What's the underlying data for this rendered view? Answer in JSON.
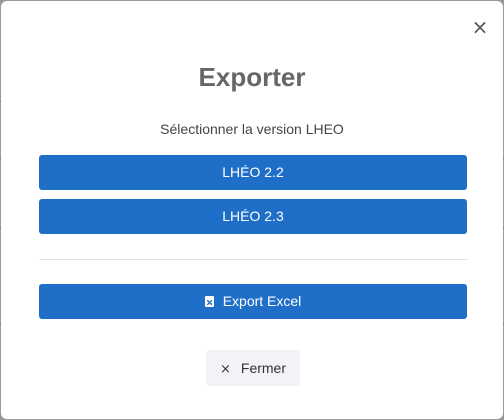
{
  "modal": {
    "close_symbol": "×",
    "title": "Exporter",
    "subtitle": "Sélectionner la version LHEO",
    "buttons": {
      "lheo_22": "LHÉO 2.2",
      "lheo_23": "LHÉO 2.3",
      "export_excel": "Export Excel",
      "export_excel_icon": "file-excel-icon",
      "fermer": "Fermer",
      "fermer_symbol": "×"
    }
  },
  "colors": {
    "primary": "#1f6fc9",
    "title": "#666666",
    "secondary_bg": "#f1f3f6",
    "overlay": "#9a9a9a"
  }
}
